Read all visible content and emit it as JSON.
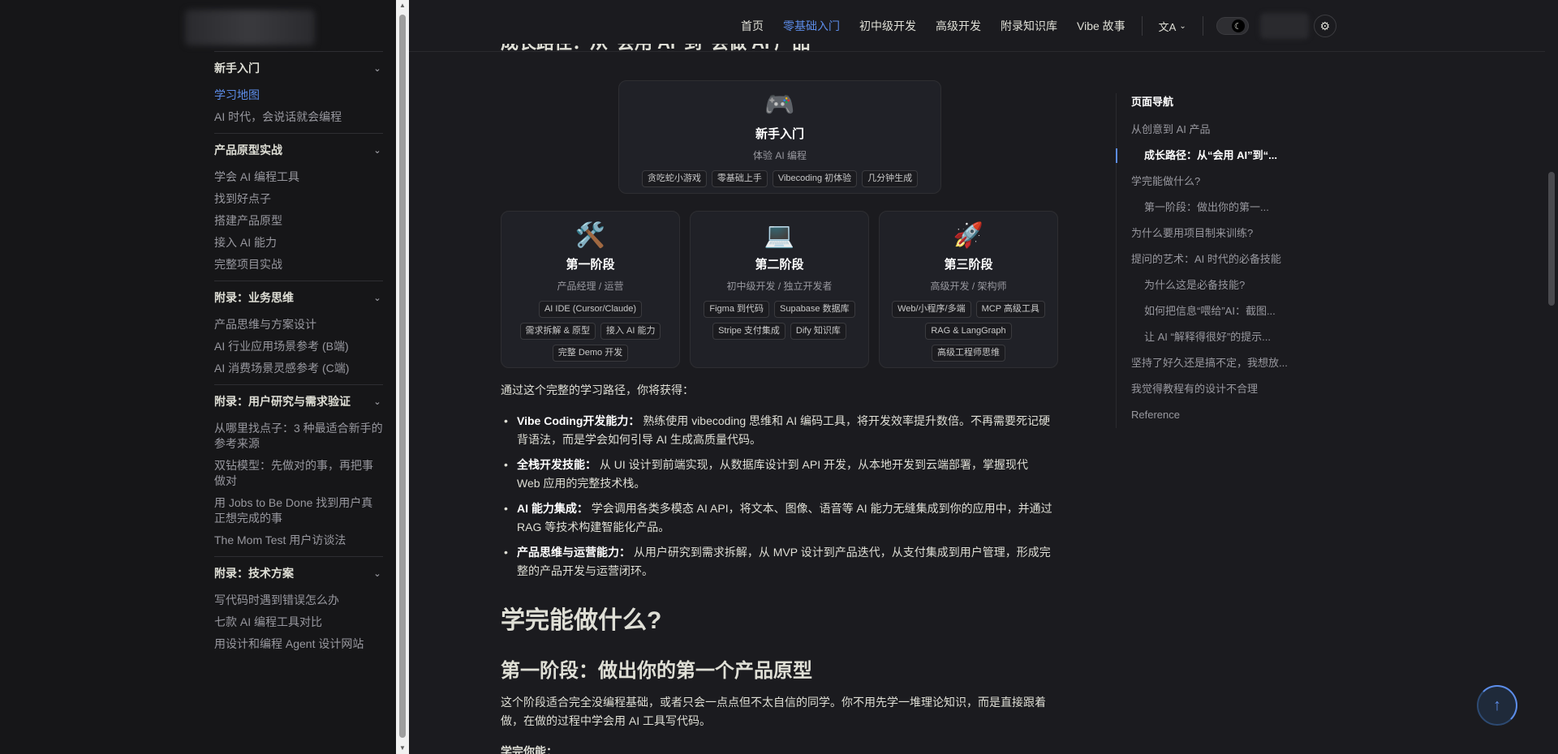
{
  "sidebar": {
    "groups": [
      {
        "title": "新手入门",
        "items": [
          {
            "label": "学习地图",
            "active": true
          },
          {
            "label": "AI 时代，会说话就会编程"
          }
        ]
      },
      {
        "title": "产品原型实战",
        "items": [
          {
            "label": "学会 AI 编程工具"
          },
          {
            "label": "找到好点子"
          },
          {
            "label": "搭建产品原型"
          },
          {
            "label": "接入 AI 能力"
          },
          {
            "label": "完整项目实战"
          }
        ]
      },
      {
        "title": "附录：业务思维",
        "items": [
          {
            "label": "产品思维与方案设计"
          },
          {
            "label": "AI 行业应用场景参考 (B端)"
          },
          {
            "label": "AI 消费场景灵感参考 (C端)"
          }
        ]
      },
      {
        "title": "附录：用户研究与需求验证",
        "items": [
          {
            "label": "从哪里找点子：3 种最适合新手的参考来源"
          },
          {
            "label": "双钻模型：先做对的事，再把事做对"
          },
          {
            "label": "用 Jobs to Be Done 找到用户真正想完成的事"
          },
          {
            "label": "The Mom Test 用户访谈法"
          }
        ]
      },
      {
        "title": "附录：技术方案",
        "items": [
          {
            "label": "写代码时遇到错误怎么办"
          },
          {
            "label": "七款 AI 编程工具对比"
          },
          {
            "label": "用设计和编程 Agent 设计网站"
          }
        ]
      }
    ]
  },
  "nav": {
    "links": [
      {
        "label": "首页"
      },
      {
        "label": "零基础入门",
        "active": true
      },
      {
        "label": "初中级开发"
      },
      {
        "label": "高级开发"
      },
      {
        "label": "附录知识库"
      },
      {
        "label": "Vibe 故事"
      }
    ],
    "translate_icon": "translate-icon",
    "theme_icon": "moon-icon",
    "settings_icon": "gear-icon"
  },
  "main": {
    "partial_heading": "成长路径：从“会用 AI”到“会做 AI 产品”",
    "cards": [
      {
        "emoji": "🎮",
        "title": "新手入门",
        "sub": "体验 AI 编程",
        "tags": [
          "贪吃蛇小游戏",
          "零基础上手",
          "Vibecoding 初体验",
          "几分钟生成"
        ]
      },
      {
        "emoji": "🛠️",
        "title": "第一阶段",
        "sub": "产品经理 / 运营",
        "tags": [
          "AI IDE (Cursor/Claude)",
          "需求拆解 & 原型",
          "接入 AI 能力",
          "完整 Demo 开发"
        ]
      },
      {
        "emoji": "💻",
        "title": "第二阶段",
        "sub": "初中级开发 / 独立开发者",
        "tags": [
          "Figma 到代码",
          "Supabase 数据库",
          "Stripe 支付集成",
          "Dify 知识库"
        ]
      },
      {
        "emoji": "🚀",
        "title": "第三阶段",
        "sub": "高级开发 / 架构师",
        "tags": [
          "Web/小程序/多端",
          "MCP 高级工具",
          "RAG & LangGraph",
          "高级工程师思维"
        ]
      }
    ],
    "intro": "通过这个完整的学习路径，你将获得：",
    "bullets": [
      {
        "bold": "Vibe Coding开发能力：",
        "text": "熟练使用 vibecoding 思维和 AI 编码工具，将开发效率提升数倍。不再需要死记硬背语法，而是学会如何引导 AI 生成高质量代码。"
      },
      {
        "bold": "全栈开发技能：",
        "text": "从 UI 设计到前端实现，从数据库设计到 API 开发，从本地开发到云端部署，掌握现代 Web 应用的完整技术栈。"
      },
      {
        "bold": "AI 能力集成：",
        "text": "学会调用各类多模态 AI API，将文本、图像、语音等 AI 能力无缝集成到你的应用中，并通过 RAG 等技术构建智能化产品。"
      },
      {
        "bold": "产品思维与运营能力：",
        "text": "从用户研究到需求拆解，从 MVP 设计到产品迭代，从支付集成到用户管理，形成完整的产品开发与运营闭环。"
      }
    ],
    "h2": "学完能做什么?",
    "h3": "第一阶段：做出你的第一个产品原型",
    "para": "这个阶段适合完全没编程基础，或者只会一点点但不太自信的同学。你不用先学一堆理论知识，而是直接跟着做，在做的过程中学会用 AI 工具写代码。",
    "cutoff": "学完你能："
  },
  "toc": {
    "title": "页面导航",
    "items": [
      {
        "label": "从创意到 AI 产品",
        "level": 1
      },
      {
        "label": "成长路径：从“会用 AI”到“...",
        "level": 2,
        "active": true
      },
      {
        "label": "学完能做什么?",
        "level": 1
      },
      {
        "label": "第一阶段：做出你的第一...",
        "level": 2
      },
      {
        "label": "为什么要用项目制来训练?",
        "level": 1
      },
      {
        "label": "提问的艺术：AI 时代的必备技能",
        "level": 1
      },
      {
        "label": "为什么这是必备技能?",
        "level": 2
      },
      {
        "label": "如何把信息“喂给”AI：截图...",
        "level": 2
      },
      {
        "label": "让 AI “解释得很好”的提示...",
        "level": 2
      },
      {
        "label": "坚持了好久还是搞不定，我想放...",
        "level": 1
      },
      {
        "label": "我觉得教程有的设计不合理",
        "level": 1
      },
      {
        "label": "Reference",
        "level": 1
      }
    ]
  },
  "back_to_top_icon": "arrow-up-icon"
}
